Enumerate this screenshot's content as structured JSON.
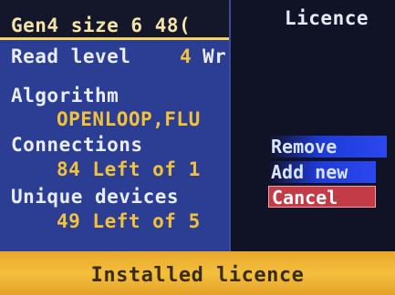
{
  "info_panel": {
    "header": "Gen4 size 6 48(",
    "read_level_label": "Read level",
    "read_level_value": "4",
    "read_level_suffix": "Wr",
    "algorithm_label": "Algorithm",
    "algorithm_value": "OPENLOOP,FLU",
    "connections_label": "Connections",
    "connections_value": "84 Left of 1",
    "unique_devices_label": "Unique devices",
    "unique_devices_value": "49 Left of 5"
  },
  "licence_menu": {
    "title": "Licence",
    "items": [
      {
        "label": "Remove",
        "selected": false
      },
      {
        "label": "Add new",
        "selected": false
      },
      {
        "label": "Cancel",
        "selected": true
      }
    ]
  },
  "footer": {
    "status": "Installed licence"
  },
  "colors": {
    "panel_blue": "#2b3e93",
    "menu_dark": "#101326",
    "label_yellow": "#f2c23b",
    "highlight_red": "#c33b47",
    "item_blue": "#2a48ef",
    "footer_orange": "#f3c03c"
  }
}
